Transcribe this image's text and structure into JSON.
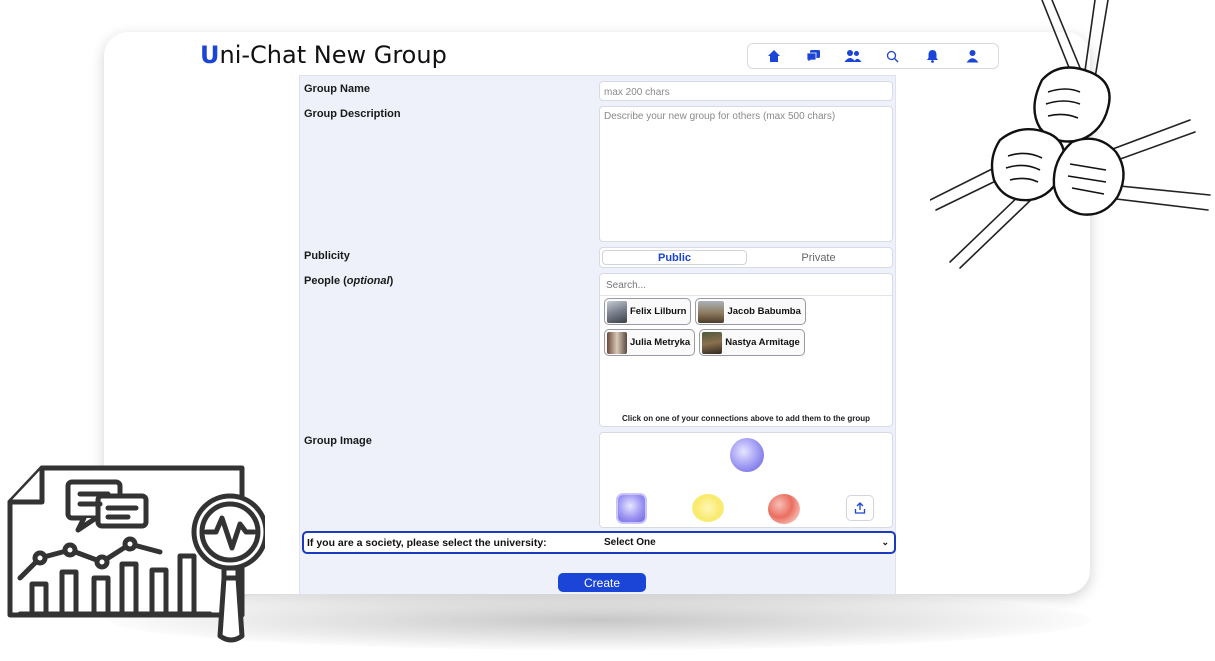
{
  "app": {
    "title_letter": "U",
    "title_rest": "ni-Chat New Group"
  },
  "nav": {
    "items": [
      {
        "icon": "home-icon"
      },
      {
        "icon": "chat-icon"
      },
      {
        "icon": "people-icon"
      },
      {
        "icon": "search-icon"
      },
      {
        "icon": "bell-icon"
      },
      {
        "icon": "user-icon"
      }
    ],
    "accent": "#1a45d6"
  },
  "form": {
    "group_name_label": "Group Name",
    "group_name_placeholder": "max 200 chars",
    "group_description_label": "Group Description",
    "group_description_placeholder": "Describe your new group for others (max 500 chars)",
    "publicity_label": "Publicity",
    "publicity_options": {
      "public": "Public",
      "private": "Private",
      "selected": "Public"
    },
    "people_label_prefix": "People (",
    "people_label_em": "optional",
    "people_label_suffix": ")",
    "people_search_placeholder": "Search...",
    "people": [
      {
        "name": "Felix Lilburn"
      },
      {
        "name": "Jacob Babumba"
      },
      {
        "name": "Julia Metryka"
      },
      {
        "name": "Nastya Armitage"
      }
    ],
    "people_hint": "Click on one of your connections above to add them to the group",
    "group_image_label": "Group Image",
    "university_label": "If you are a society, please select the university:",
    "university_select_value": "Select One",
    "create_label": "Create"
  }
}
